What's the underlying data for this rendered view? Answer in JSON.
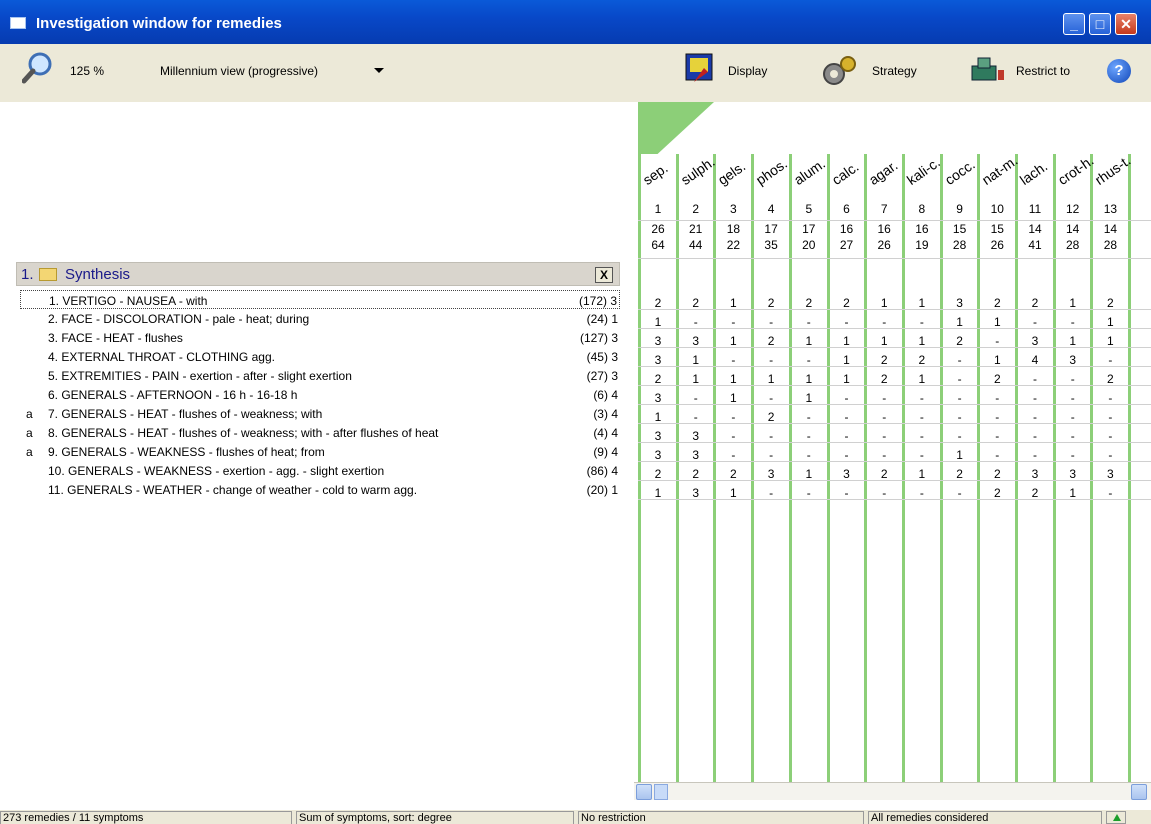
{
  "window": {
    "title": "Investigation window for remedies"
  },
  "toolbar": {
    "zoom": "125 %",
    "view_mode": "Millennium view (progressive)",
    "display_label": "Display",
    "strategy_label": "Strategy",
    "restrict_label": "Restrict to",
    "help_label": "?"
  },
  "synthesis": {
    "number": "1.",
    "title": "Synthesis",
    "close_label": "X"
  },
  "rubrics": [
    {
      "prefix": "",
      "text": "1. VERTIGO - NAUSEA - with",
      "count": "(172) 3"
    },
    {
      "prefix": "",
      "text": "2. FACE - DISCOLORATION - pale - heat; during",
      "count": "(24) 1"
    },
    {
      "prefix": "",
      "text": "3. FACE - HEAT - flushes",
      "count": "(127) 3"
    },
    {
      "prefix": "",
      "text": "4. EXTERNAL THROAT - CLOTHING agg.",
      "count": "(45) 3"
    },
    {
      "prefix": "",
      "text": "5. EXTREMITIES - PAIN - exertion - after - slight exertion",
      "count": "(27) 3"
    },
    {
      "prefix": "",
      "text": "6. GENERALS - AFTERNOON - 16 h - 16-18 h",
      "count": "(6) 4"
    },
    {
      "prefix": "a",
      "text": "7. GENERALS - HEAT - flushes of - weakness; with",
      "count": "(3) 4"
    },
    {
      "prefix": "a",
      "text": "8. GENERALS - HEAT - flushes of - weakness; with - after flushes of heat",
      "count": "(4) 4"
    },
    {
      "prefix": "a",
      "text": "9. GENERALS - WEAKNESS - flushes of heat; from",
      "count": "(9) 4"
    },
    {
      "prefix": "",
      "text": "10. GENERALS - WEAKNESS - exertion - agg. - slight exertion",
      "count": "(86) 4"
    },
    {
      "prefix": "",
      "text": "11. GENERALS - WEATHER - change of weather - cold to warm agg.",
      "count": "(20) 1"
    }
  ],
  "remedies": [
    {
      "name": "sep.",
      "num": "1",
      "s1": "26",
      "s2": "64",
      "cells": [
        "2",
        "1",
        "3",
        "3",
        "2",
        "3",
        "1",
        "3",
        "3",
        "2",
        "1"
      ]
    },
    {
      "name": "sulph.",
      "num": "2",
      "s1": "21",
      "s2": "44",
      "cells": [
        "2",
        "-",
        "3",
        "1",
        "1",
        "-",
        "-",
        "3",
        "3",
        "2",
        "3"
      ]
    },
    {
      "name": "gels.",
      "num": "3",
      "s1": "18",
      "s2": "22",
      "cells": [
        "1",
        "-",
        "1",
        "-",
        "1",
        "1",
        "-",
        "-",
        "-",
        "2",
        "1"
      ]
    },
    {
      "name": "phos.",
      "num": "4",
      "s1": "17",
      "s2": "35",
      "cells": [
        "2",
        "-",
        "2",
        "-",
        "1",
        "-",
        "2",
        "-",
        "-",
        "3",
        "-"
      ]
    },
    {
      "name": "alum.",
      "num": "5",
      "s1": "17",
      "s2": "20",
      "cells": [
        "2",
        "-",
        "1",
        "-",
        "1",
        "1",
        "-",
        "-",
        "-",
        "1",
        "-"
      ]
    },
    {
      "name": "calc.",
      "num": "6",
      "s1": "16",
      "s2": "27",
      "cells": [
        "2",
        "-",
        "1",
        "1",
        "1",
        "-",
        "-",
        "-",
        "-",
        "3",
        "-"
      ]
    },
    {
      "name": "agar.",
      "num": "7",
      "s1": "16",
      "s2": "26",
      "cells": [
        "1",
        "-",
        "1",
        "2",
        "2",
        "-",
        "-",
        "-",
        "-",
        "2",
        "-"
      ]
    },
    {
      "name": "kali-c.",
      "num": "8",
      "s1": "16",
      "s2": "19",
      "cells": [
        "1",
        "-",
        "1",
        "2",
        "1",
        "-",
        "-",
        "-",
        "-",
        "1",
        "-"
      ]
    },
    {
      "name": "cocc.",
      "num": "9",
      "s1": "15",
      "s2": "28",
      "cells": [
        "3",
        "1",
        "2",
        "-",
        "-",
        "-",
        "-",
        "-",
        "1",
        "2",
        "-"
      ]
    },
    {
      "name": "nat-m.",
      "num": "10",
      "s1": "15",
      "s2": "26",
      "cells": [
        "2",
        "1",
        "-",
        "1",
        "2",
        "-",
        "-",
        "-",
        "-",
        "2",
        "2"
      ]
    },
    {
      "name": "lach.",
      "num": "11",
      "s1": "14",
      "s2": "41",
      "cells": [
        "2",
        "-",
        "3",
        "4",
        "-",
        "-",
        "-",
        "-",
        "-",
        "3",
        "2"
      ]
    },
    {
      "name": "crot-h.",
      "num": "12",
      "s1": "14",
      "s2": "28",
      "cells": [
        "1",
        "-",
        "1",
        "3",
        "-",
        "-",
        "-",
        "-",
        "-",
        "3",
        "1"
      ]
    },
    {
      "name": "rhus-t.",
      "num": "13",
      "s1": "14",
      "s2": "28",
      "cells": [
        "2",
        "1",
        "1",
        "-",
        "2",
        "-",
        "-",
        "-",
        "-",
        "3",
        "-"
      ]
    }
  ],
  "status": {
    "remedies": "273 remedies / 11 symptoms",
    "sort": "Sum of symptoms, sort: degree",
    "restriction": "No restriction",
    "considered": "All remedies considered"
  },
  "colors": {
    "grid_accent": "#8ccf78",
    "title_bar": "#0848c8"
  }
}
